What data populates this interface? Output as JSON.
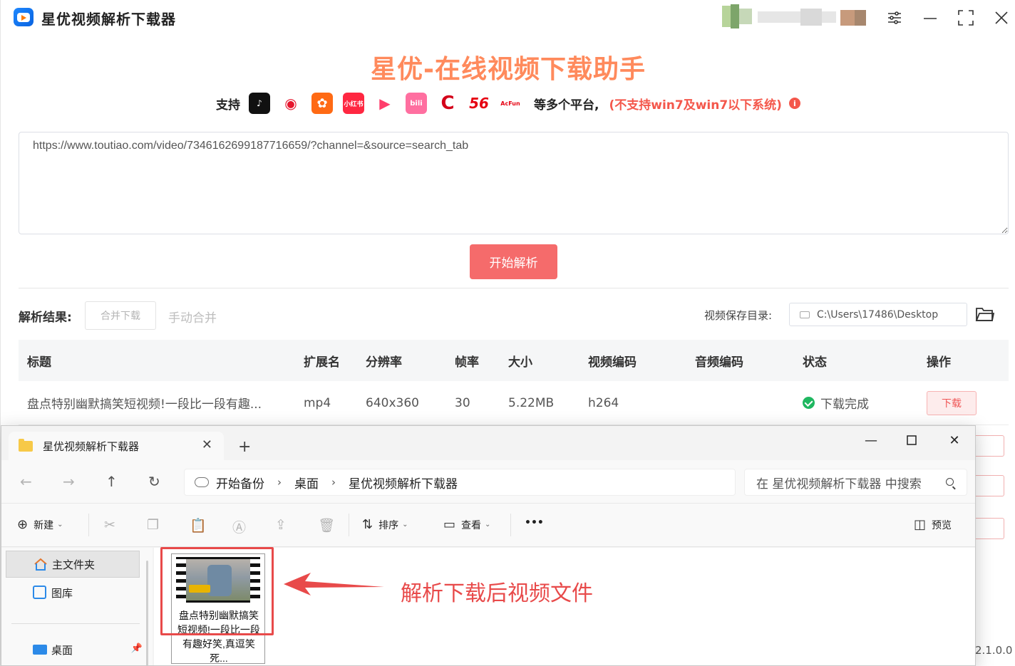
{
  "app": {
    "title": "星优视频解析下载器",
    "headline": "星优-在线视频下载助手",
    "support_label": "支持",
    "support_more": "等多个平台,",
    "support_warning": "(不支持win7及win7以下系统)",
    "platforms": [
      {
        "name": "tiktok-icon",
        "color": "#111111",
        "glyph": "♪"
      },
      {
        "name": "weibo-icon",
        "color": "#f5a623",
        "glyph": "◉"
      },
      {
        "name": "kuaishou-icon",
        "color": "#ff6a14",
        "glyph": "✿"
      },
      {
        "name": "xiaohongshu-icon",
        "color": "#ff2741",
        "glyph": "小红书"
      },
      {
        "name": "xigua-icon",
        "color": "#ffffff",
        "glyph": "▶"
      },
      {
        "name": "bilibili-icon",
        "color": "#ff6fa0",
        "glyph": "bili"
      },
      {
        "name": "cntv-icon",
        "color": "#ffffff",
        "glyph": "C"
      },
      {
        "name": "56-icon",
        "color": "#ffffff",
        "glyph": "56"
      },
      {
        "name": "acfun-icon",
        "color": "#ffffff",
        "glyph": "AcFun"
      }
    ],
    "url_value": "https://www.toutiao.com/video/7346162699187716659/?channel=&source=search_tab",
    "parse_button": "开始解析",
    "result_label": "解析结果:",
    "merge_download": "合并下载",
    "manual_merge": "手动合并",
    "save_dir_label": "视频保存目录:",
    "save_dir_value": "C:\\Users\\17486\\Desktop",
    "version": "2.1.0.0",
    "colors": {
      "accent": "#f56b6b",
      "headline": "#ff8a5c",
      "success": "#1fb760"
    }
  },
  "table": {
    "headers": {
      "title": "标题",
      "ext": "扩展名",
      "resolution": "分辨率",
      "fps": "帧率",
      "size": "大小",
      "vcodec": "视频编码",
      "acodec": "音频编码",
      "status": "状态",
      "op": "操作"
    },
    "rows": [
      {
        "title": "盘点特别幽默搞笑短视频!一段比一段有趣...",
        "ext": "mp4",
        "resolution": "640x360",
        "fps": "30",
        "size": "5.22MB",
        "vcodec": "h264",
        "acodec": "",
        "status": "下载完成",
        "op": "下载"
      }
    ]
  },
  "explorer": {
    "tab_title": "星优视频解析下载器",
    "breadcrumb": [
      "开始备份",
      "桌面",
      "星优视频解析下载器"
    ],
    "search_placeholder": "在 星优视频解析下载器 中搜索",
    "toolbar": {
      "new": "新建",
      "sort": "排序",
      "view": "查看",
      "more": "•••",
      "preview": "预览"
    },
    "sidebar": {
      "home": "主文件夹",
      "gallery": "图库",
      "desktop": "桌面"
    },
    "file": {
      "name": "盘点特别幽默搞笑短视频!一段比一段有趣好笑,真逗笑死..."
    }
  },
  "annotation": {
    "text": "解析下载后视频文件"
  }
}
